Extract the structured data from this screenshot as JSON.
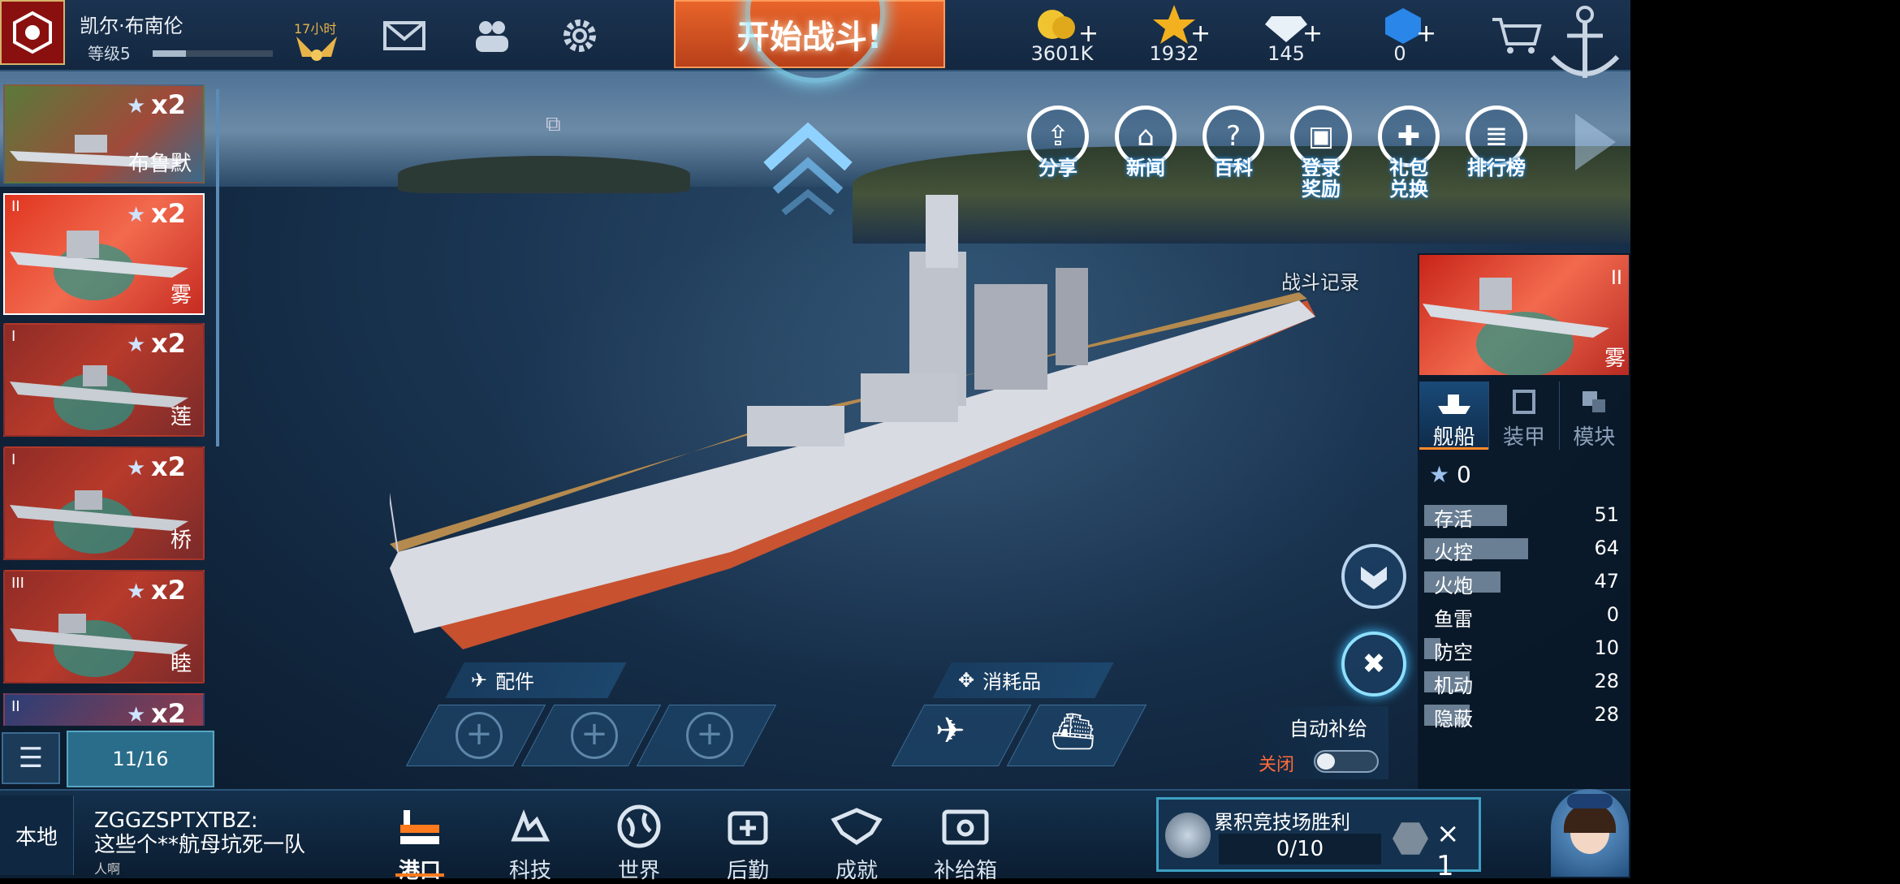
{
  "player": {
    "name": "凯尔·布南伦",
    "level": "等级5",
    "xp_fraction": 0.28,
    "timer": "17小时"
  },
  "top": {
    "battle_button": "开始战斗!",
    "resources": [
      {
        "icon": "gold-coin-icon",
        "value": "3601K"
      },
      {
        "icon": "star-icon",
        "value": "1932"
      },
      {
        "icon": "diamond-icon",
        "value": "145"
      },
      {
        "icon": "blue-gem-icon",
        "value": "0"
      }
    ]
  },
  "fleet": {
    "cards": [
      {
        "name": "布鲁默",
        "multiplier": "x2",
        "rank": ""
      },
      {
        "name": "雾",
        "multiplier": "x2",
        "rank": "II"
      },
      {
        "name": "莲",
        "multiplier": "x2",
        "rank": "I"
      },
      {
        "name": "桥",
        "multiplier": "x2",
        "rank": "I"
      },
      {
        "name": "睦",
        "multiplier": "x2",
        "rank": "III"
      },
      {
        "name": "",
        "multiplier": "x2",
        "rank": "II"
      }
    ],
    "count": "11/16"
  },
  "functions": [
    {
      "label": "分享",
      "icon": "share-icon"
    },
    {
      "label": "新闻",
      "icon": "news-icon"
    },
    {
      "label": "百科",
      "icon": "encyclopedia-icon"
    },
    {
      "label": "登录\n奖励",
      "icon": "login-reward-icon"
    },
    {
      "label": "礼包\n兑换",
      "icon": "gift-exchange-icon"
    },
    {
      "label": "排行榜",
      "icon": "leaderboard-icon"
    }
  ],
  "battle_log": "战斗记录",
  "right_panel": {
    "ship_name": "雾",
    "ship_rank": "II",
    "tabs": [
      "舰船",
      "装甲",
      "模块"
    ],
    "stars": "0",
    "stats": [
      {
        "label": "存活",
        "value": "51"
      },
      {
        "label": "火控",
        "value": "64"
      },
      {
        "label": "火炮",
        "value": "47"
      },
      {
        "label": "鱼雷",
        "value": "0"
      },
      {
        "label": "防空",
        "value": "10"
      },
      {
        "label": "机动",
        "value": "28"
      },
      {
        "label": "隐蔽",
        "value": "28"
      }
    ]
  },
  "slots": {
    "parts_label": "配件",
    "consumables_label": "消耗品"
  },
  "auto_supply": {
    "title": "自动补给",
    "state": "关闭"
  },
  "chat": {
    "tab": "本地",
    "sender": "ZGGZSPTXTBZ:",
    "message": "这些个**航母坑死一队",
    "tail": "人啊"
  },
  "nav": [
    {
      "label": "港口",
      "icon": "harbor-icon"
    },
    {
      "label": "科技",
      "icon": "tech-icon"
    },
    {
      "label": "世界",
      "icon": "globe-icon"
    },
    {
      "label": "后勤",
      "icon": "logistics-icon"
    },
    {
      "label": "成就",
      "icon": "achievement-icon"
    },
    {
      "label": "补给箱",
      "icon": "supply-box-icon"
    }
  ],
  "arena": {
    "title": "累积竞技场胜利",
    "progress": "0/10",
    "multiplier": "× 1"
  }
}
